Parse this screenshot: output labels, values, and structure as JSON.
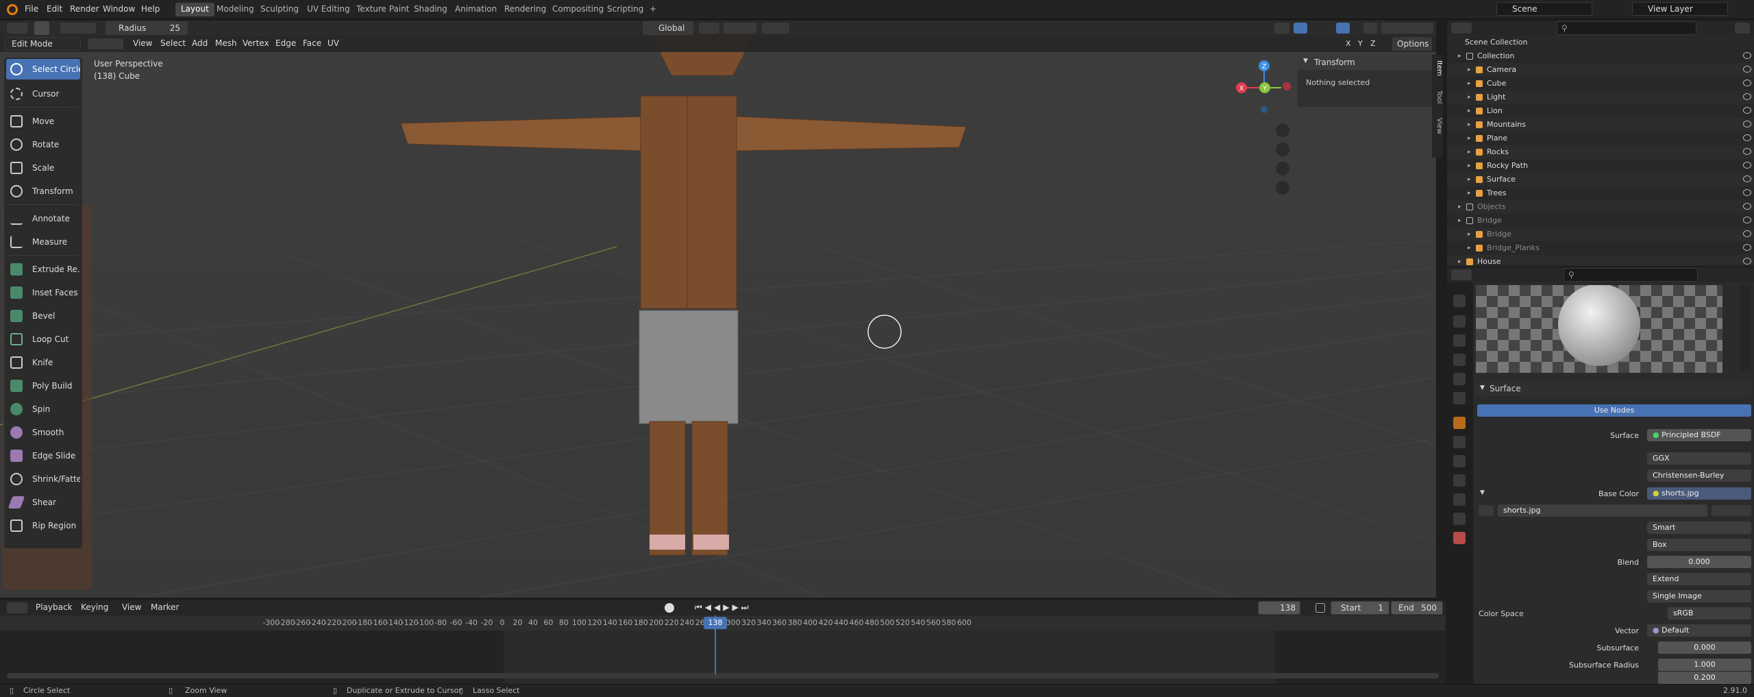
{
  "menubar": {
    "items": [
      "File",
      "Edit",
      "Render",
      "Window",
      "Help"
    ],
    "workspaces": [
      "Layout",
      "Modeling",
      "Sculpting",
      "UV Editing",
      "Texture Paint",
      "Shading",
      "Animation",
      "Rendering",
      "Compositing",
      "Scripting"
    ],
    "active_workspace": "Layout",
    "add_workspace": "+",
    "scene": "Scene",
    "view_layer": "View Layer"
  },
  "viewport_header": {
    "radius_label": "Radius",
    "radius_value": "25",
    "orientation": "Global",
    "axes": [
      "X",
      "Y",
      "Z"
    ],
    "options": "Options"
  },
  "tool_header": {
    "mode": "Edit Mode",
    "menus": [
      "View",
      "Select",
      "Add",
      "Mesh",
      "Vertex",
      "Edge",
      "Face",
      "UV"
    ]
  },
  "viewport": {
    "perspective": "User Perspective",
    "object_info": "(138) Cube",
    "gizmo_axes": {
      "x": "X",
      "y": "Y",
      "z": "Z"
    },
    "colors": {
      "bg": "#3c3c3c",
      "skin": "#7a4e2d",
      "shorts": "#8a8a8a",
      "x_axis": "#e23b50",
      "y_axis": "#8bc53f",
      "z_axis": "#3b8fe2"
    }
  },
  "toolbar": {
    "items": [
      {
        "label": "Select Circle",
        "icon": "select-circle-icon",
        "active": true
      },
      {
        "label": "Cursor",
        "icon": "cursor-icon"
      },
      {
        "label": "Move",
        "icon": "move-icon"
      },
      {
        "label": "Rotate",
        "icon": "rotate-icon"
      },
      {
        "label": "Scale",
        "icon": "scale-icon"
      },
      {
        "label": "Transform",
        "icon": "transform-icon"
      },
      {
        "label": "Annotate",
        "icon": "annotate-icon"
      },
      {
        "label": "Measure",
        "icon": "measure-icon"
      },
      {
        "label": "Extrude Re...",
        "icon": "extrude-icon"
      },
      {
        "label": "Inset Faces",
        "icon": "inset-icon"
      },
      {
        "label": "Bevel",
        "icon": "bevel-icon"
      },
      {
        "label": "Loop Cut",
        "icon": "loop-cut-icon"
      },
      {
        "label": "Knife",
        "icon": "knife-icon"
      },
      {
        "label": "Poly Build",
        "icon": "poly-build-icon"
      },
      {
        "label": "Spin",
        "icon": "spin-icon"
      },
      {
        "label": "Smooth",
        "icon": "smooth-icon"
      },
      {
        "label": "Edge Slide",
        "icon": "edge-slide-icon"
      },
      {
        "label": "Shrink/Fatten",
        "icon": "shrink-icon"
      },
      {
        "label": "Shear",
        "icon": "shear-icon"
      },
      {
        "label": "Rip Region",
        "icon": "rip-icon"
      }
    ]
  },
  "npanel": {
    "section": "Transform",
    "message": "Nothing selected",
    "tabs": [
      "Item",
      "Tool",
      "View"
    ]
  },
  "timeline": {
    "menus": [
      "Playback",
      "Keying",
      "View",
      "Marker"
    ],
    "current_frame": "138",
    "start_label": "Start",
    "start": "1",
    "end_label": "End",
    "end": "500",
    "ticks": [
      "-300",
      "-280",
      "-260",
      "-240",
      "-220",
      "-200",
      "-180",
      "-160",
      "-140",
      "-120",
      "-100",
      "-80",
      "-60",
      "-40",
      "-20",
      "0",
      "20",
      "40",
      "60",
      "80",
      "100",
      "120",
      "140",
      "160",
      "180",
      "200",
      "220",
      "240",
      "260",
      "280",
      "300",
      "320",
      "340",
      "360",
      "380",
      "400",
      "420",
      "440",
      "460",
      "480",
      "500",
      "520",
      "540",
      "560",
      "580",
      "600"
    ],
    "playhead": "138"
  },
  "outliner": {
    "root": "Scene Collection",
    "rows": [
      {
        "name": "Collection",
        "depth": 1,
        "type": "collection"
      },
      {
        "name": "Camera",
        "depth": 2,
        "type": "camera"
      },
      {
        "name": "Cube",
        "depth": 2,
        "type": "mesh"
      },
      {
        "name": "Light",
        "depth": 2,
        "type": "light"
      },
      {
        "name": "Lion",
        "depth": 2,
        "type": "mesh"
      },
      {
        "name": "Mountains",
        "depth": 2,
        "type": "mesh"
      },
      {
        "name": "Plane",
        "depth": 2,
        "type": "mesh"
      },
      {
        "name": "Rocks",
        "depth": 2,
        "type": "mesh"
      },
      {
        "name": "Rocky Path",
        "depth": 2,
        "type": "mesh"
      },
      {
        "name": "Surface",
        "depth": 2,
        "type": "mesh"
      },
      {
        "name": "Trees",
        "depth": 2,
        "type": "mesh"
      },
      {
        "name": "Objects",
        "depth": 1,
        "type": "collection",
        "dim": true
      },
      {
        "name": "Bridge",
        "depth": 1,
        "type": "collection",
        "dim": true
      },
      {
        "name": "Bridge",
        "depth": 2,
        "type": "mesh",
        "dim": true
      },
      {
        "name": "Bridge_Planks",
        "depth": 2,
        "type": "mesh",
        "dim": true
      },
      {
        "name": "House",
        "depth": 1,
        "type": "mesh"
      }
    ]
  },
  "properties": {
    "section": "Surface",
    "use_nodes": "Use Nodes",
    "surface_label": "Surface",
    "surface_value": "Principled BSDF",
    "distribution": "GGX",
    "subsurface_method": "Christensen-Burley",
    "base_color_label": "Base Color",
    "base_color_value": "shorts.jpg",
    "image_name": "shorts.jpg",
    "interpolation": "Smart",
    "projection": "Box",
    "blend_label": "Blend",
    "blend_value": "0.000",
    "extension": "Extend",
    "source": "Single Image",
    "color_space_label": "Color Space",
    "color_space_value": "sRGB",
    "vector_label": "Vector",
    "vector_value": "Default",
    "subsurface_label": "Subsurface",
    "subsurface_value": "0.000",
    "subsurface_radius_label": "Subsurface Radius",
    "subsurface_radius_1": "1.000",
    "subsurface_radius_2": "0.200"
  },
  "statusbar": {
    "items": [
      "Circle Select",
      "Zoom View",
      "Duplicate or Extrude to Cursor",
      "Lasso Select"
    ],
    "version": "2.91.0"
  }
}
